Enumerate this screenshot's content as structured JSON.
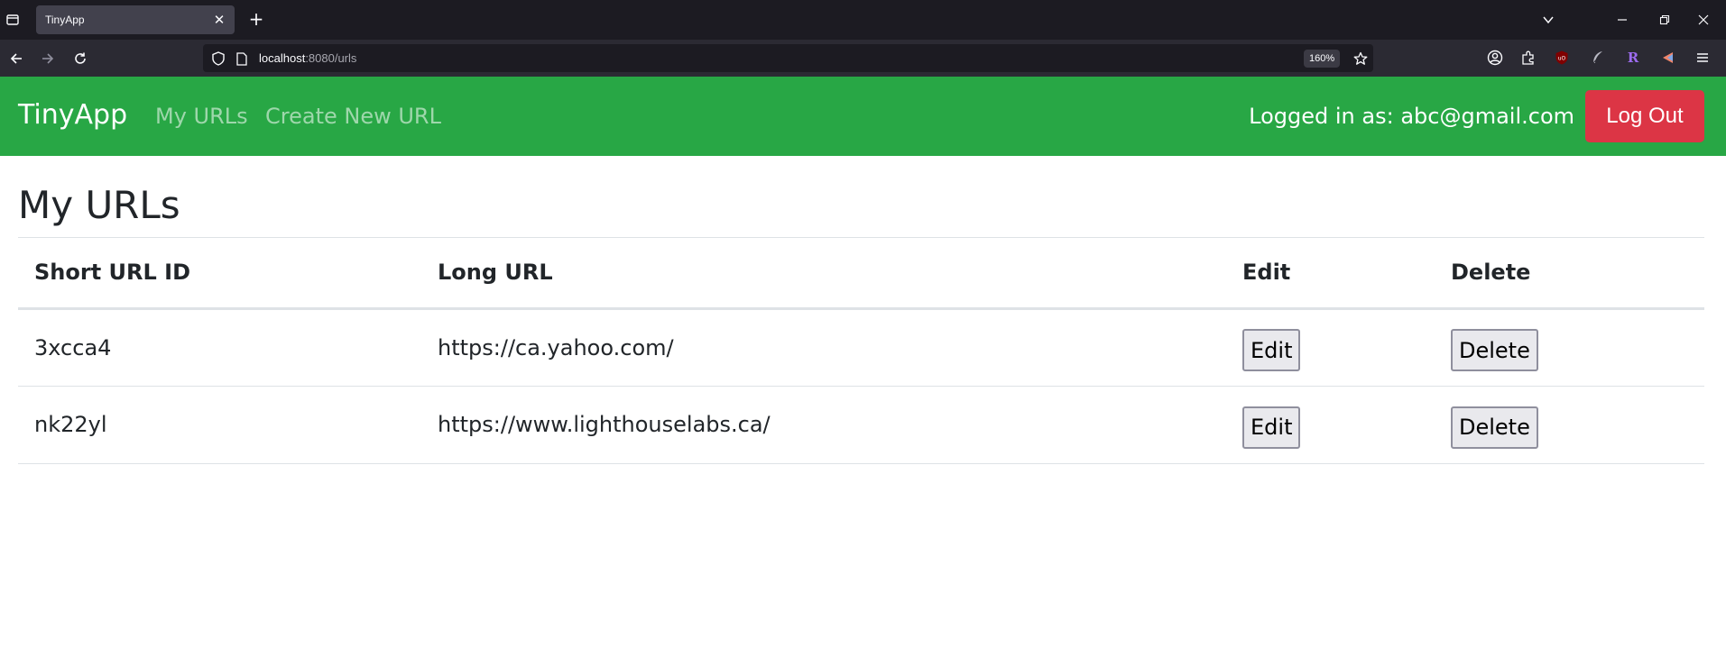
{
  "browser": {
    "tab_title": "TinyApp",
    "url_host": "localhost",
    "url_rest": ":8080/urls",
    "zoom": "160%"
  },
  "app": {
    "brand": "TinyApp",
    "nav_links": [
      "My URLs",
      "Create New URL"
    ],
    "logged_in_text": "Logged in as: abc@gmail.com",
    "logout_label": "Log Out",
    "colors": {
      "navbar": "#28a745",
      "logout": "#dc3545"
    }
  },
  "main": {
    "title": "My URLs",
    "columns": [
      "Short URL ID",
      "Long URL",
      "Edit",
      "Delete"
    ],
    "rows": [
      {
        "short_id": "3xcca4",
        "long_url": "https://ca.yahoo.com/",
        "edit_label": "Edit",
        "delete_label": "Delete"
      },
      {
        "short_id": "nk22yl",
        "long_url": "https://www.lighthouselabs.ca/",
        "edit_label": "Edit",
        "delete_label": "Delete"
      }
    ]
  }
}
